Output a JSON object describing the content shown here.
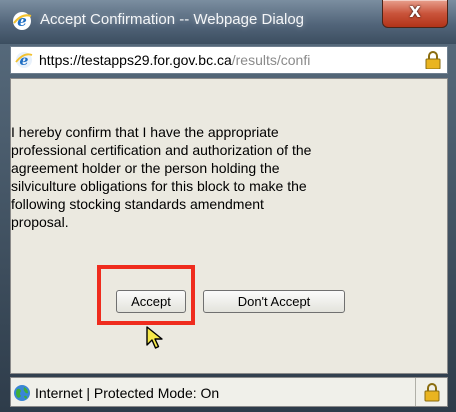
{
  "window": {
    "title": "Accept Confirmation -- Webpage Dialog",
    "close_glyph": "X"
  },
  "address_bar": {
    "host": "https://testapps29.for.gov.bc.ca",
    "path": "/results/confi"
  },
  "dialog": {
    "message_lines": [
      "I hereby confirm that I have the appropriate",
      "professional certification and authorization of the",
      "agreement holder or the person holding the",
      "silviculture obligations for this block to make the",
      "following stocking standards amendment",
      "proposal."
    ],
    "accept_label": "Accept",
    "dont_accept_label": "Don't Accept"
  },
  "status_bar": {
    "zone_text": "Internet | Protected Mode: On"
  },
  "icons": {
    "ie": "internet-explorer-icon",
    "lock": "padlock-icon",
    "globe": "globe-icon",
    "cursor": "mouse-pointer-icon"
  },
  "colors": {
    "highlight": "#ef2c1e",
    "dialog_bg": "#ebe9e0",
    "close_button": "#c9543b"
  }
}
